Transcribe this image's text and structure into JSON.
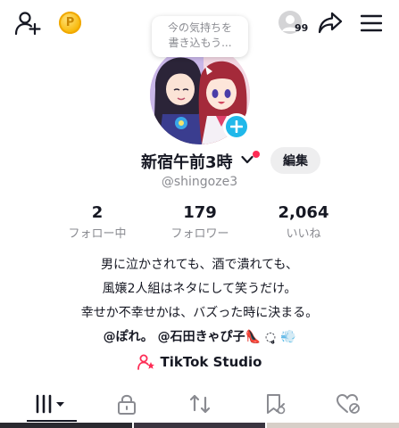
{
  "topbar": {
    "add_user_icon": "person-plus-icon",
    "coin_icon": "coin-icon",
    "coin_symbol": "P",
    "visitors_count": "99",
    "share_icon": "share-arrow-icon",
    "menu_icon": "hamburger-menu-icon"
  },
  "status_bubble": {
    "line1": "今の気持ちを",
    "line2": "書き込もう..."
  },
  "profile": {
    "display_name": "新宿午前3時",
    "handle": "@shingoze3",
    "edit_label": "編集"
  },
  "stats": [
    {
      "value": "2",
      "label": "フォロー中"
    },
    {
      "value": "179",
      "label": "フォロワー"
    },
    {
      "value": "2,064",
      "label": "いいね"
    }
  ],
  "bio": {
    "line1": "男に泣かされても、酒で潰れても、",
    "line2": "風嬢2人組はネタにして笑うだけ。",
    "line3": "幸せか不幸せかは、バズった時に決まる。",
    "line4": "@ぽれ。 @石田きゃぴ子👠 ◌̥̥̥ 💨"
  },
  "studio": {
    "label": "TikTok Studio"
  },
  "tabs": [
    {
      "name": "videos",
      "icon": "grid-bars-icon"
    },
    {
      "name": "private",
      "icon": "lock-icon"
    },
    {
      "name": "reposts",
      "icon": "repost-icon"
    },
    {
      "name": "saved",
      "icon": "bookmark-icon"
    },
    {
      "name": "liked",
      "icon": "heart-icon"
    }
  ],
  "colors": {
    "accent_red": "#fe2c55",
    "badge_blue": "#20b8ea",
    "muted_text": "#8a8b91"
  }
}
